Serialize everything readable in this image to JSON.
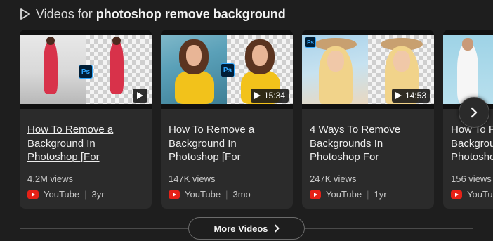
{
  "header": {
    "prefix": "Videos for ",
    "query": "photoshop remove background"
  },
  "videos": [
    {
      "title": "How To Remove a Background In Photoshop [For",
      "views": "4.2M views",
      "source": "YouTube",
      "age": "3yr",
      "duration": ""
    },
    {
      "title": "How To Remove a Background In Photoshop [For",
      "views": "147K views",
      "source": "YouTube",
      "age": "3mo",
      "duration": "15:34"
    },
    {
      "title": "4 Ways To Remove Backgrounds In Photoshop For",
      "views": "247K views",
      "source": "YouTube",
      "age": "1yr",
      "duration": "14:53"
    },
    {
      "title": "How To Remove a Background In Photoshop",
      "views": "156 views",
      "source": "YouTube",
      "age": "",
      "duration": ""
    }
  ],
  "ps_badge": "Ps",
  "more_button": "More Videos",
  "colors": {
    "background": "#1e1e1e",
    "card": "#2b2b2b",
    "youtube_red": "#e62117",
    "photoshop_blue": "#31a8ff"
  }
}
